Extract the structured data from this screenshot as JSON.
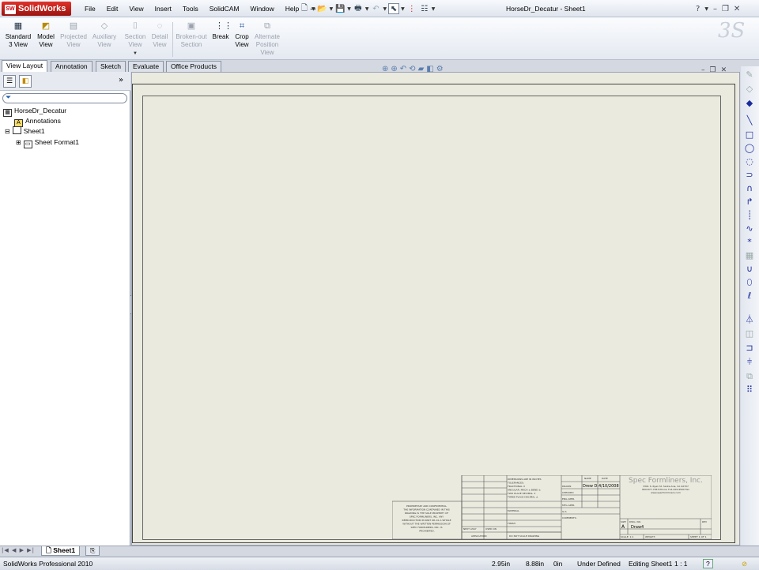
{
  "app": {
    "logo_text": "SolidWorks",
    "logo_mark": "SW",
    "document_title": "HorseDr_Decatur - Sheet1"
  },
  "menu": [
    "File",
    "Edit",
    "View",
    "Insert",
    "Tools",
    "SolidCAM",
    "Window",
    "Help"
  ],
  "window_controls": {
    "help": "?",
    "minimize": "–",
    "restore": "❐",
    "close": "✕"
  },
  "ribbon": {
    "buttons": [
      {
        "line1": "Standard",
        "line2": "3 View",
        "enabled": true,
        "icon": "standard-3-view-icon"
      },
      {
        "line1": "Model",
        "line2": "View",
        "enabled": true,
        "icon": "model-view-icon"
      },
      {
        "line1": "Projected",
        "line2": "View",
        "enabled": false,
        "icon": "projected-view-icon"
      },
      {
        "line1": "Auxiliary",
        "line2": "View",
        "enabled": false,
        "icon": "auxiliary-view-icon"
      },
      {
        "line1": "Section",
        "line2": "View",
        "enabled": false,
        "icon": "section-view-icon"
      },
      {
        "line1": "Detail",
        "line2": "View",
        "enabled": false,
        "icon": "detail-view-icon"
      },
      {
        "line1": "Broken-out",
        "line2": "Section",
        "enabled": false,
        "icon": "broken-out-section-icon"
      },
      {
        "line1": "Break",
        "line2": "",
        "enabled": true,
        "icon": "break-icon"
      },
      {
        "line1": "Crop",
        "line2": "View",
        "enabled": true,
        "icon": "crop-view-icon"
      },
      {
        "line1": "Alternate",
        "line2": "Position",
        "line3": "View",
        "enabled": false,
        "icon": "alternate-position-view-icon"
      }
    ],
    "watermark": "3S"
  },
  "tabs": [
    "View Layout",
    "Annotation",
    "Sketch",
    "Evaluate",
    "Office Products"
  ],
  "active_tab": "View Layout",
  "feature_tree": {
    "root": "HorseDr_Decatur",
    "items": [
      {
        "label": "Annotations",
        "icon": "annotations-icon"
      },
      {
        "label": "Sheet1",
        "icon": "sheet-icon"
      },
      {
        "label": "Sheet Format1",
        "icon": "sheet-format-icon"
      }
    ],
    "collapse_glyph": "»"
  },
  "title_block": {
    "company": "Spec Formliners, Inc.",
    "address": "3301 S. Ryan St. Santa Ana, CA 92707",
    "phone": "800-877-7053 Phone 714-429-9500 Fax",
    "web": "www.specformliners.com",
    "drawn_label": "DRAWN",
    "drawn_by": "Drew D.",
    "date": "4/10/2008",
    "name_col": "NAME",
    "date_col": "DATE",
    "checked": "CHECKED",
    "eng_appr": "ENG APPR.",
    "mfg_appr": "MFG APPR.",
    "qa": "Q.A.",
    "comments": "COMMENTS:",
    "size_label": "SIZE",
    "size": "A",
    "dwg_label": "DWG. NO.",
    "dwg_no": "Draw4",
    "rev": "REV",
    "scale": "SCALE: 1:1",
    "weight": "WEIGHT:",
    "sheet": "SHEET 1 OF 1",
    "dims_note": "DIMENSIONS ARE IN INCHES TOLERANCES: FRACTIONAL ± ANGULAR: MACH ± BEND ± TWO PLACE DECIMAL ± THREE PLACE DECIMAL ±",
    "material": "MATERIAL",
    "finish": "FINISH",
    "do_not_scale": "DO NOT SCALE DRAWING",
    "next_assy": "NEXT ASSY",
    "used_on": "USED ON",
    "application": "APPLICATION",
    "proprietary": "PROPRIETARY AND CONFIDENTIAL THE INFORMATION CONTAINED IN THIS DRAWING IS THE SOLE PROPERTY OF SPEC FORMLINERS, INC. ANY REPRODUCTION IN PART OR AS A WHOLE WITHOUT THE WRITTEN PERMISSION OF SPEC FORMLINERS, INC. IS PROHIBITED."
  },
  "bottom_tabs": {
    "sheet": "Sheet1"
  },
  "status": {
    "product": "SolidWorks Professional 2010",
    "x": "2.95in",
    "y": "8.88in",
    "z": "0in",
    "state": "Under Defined",
    "editing": "Editing Sheet1",
    "scale": "1 : 1",
    "help": "?"
  }
}
